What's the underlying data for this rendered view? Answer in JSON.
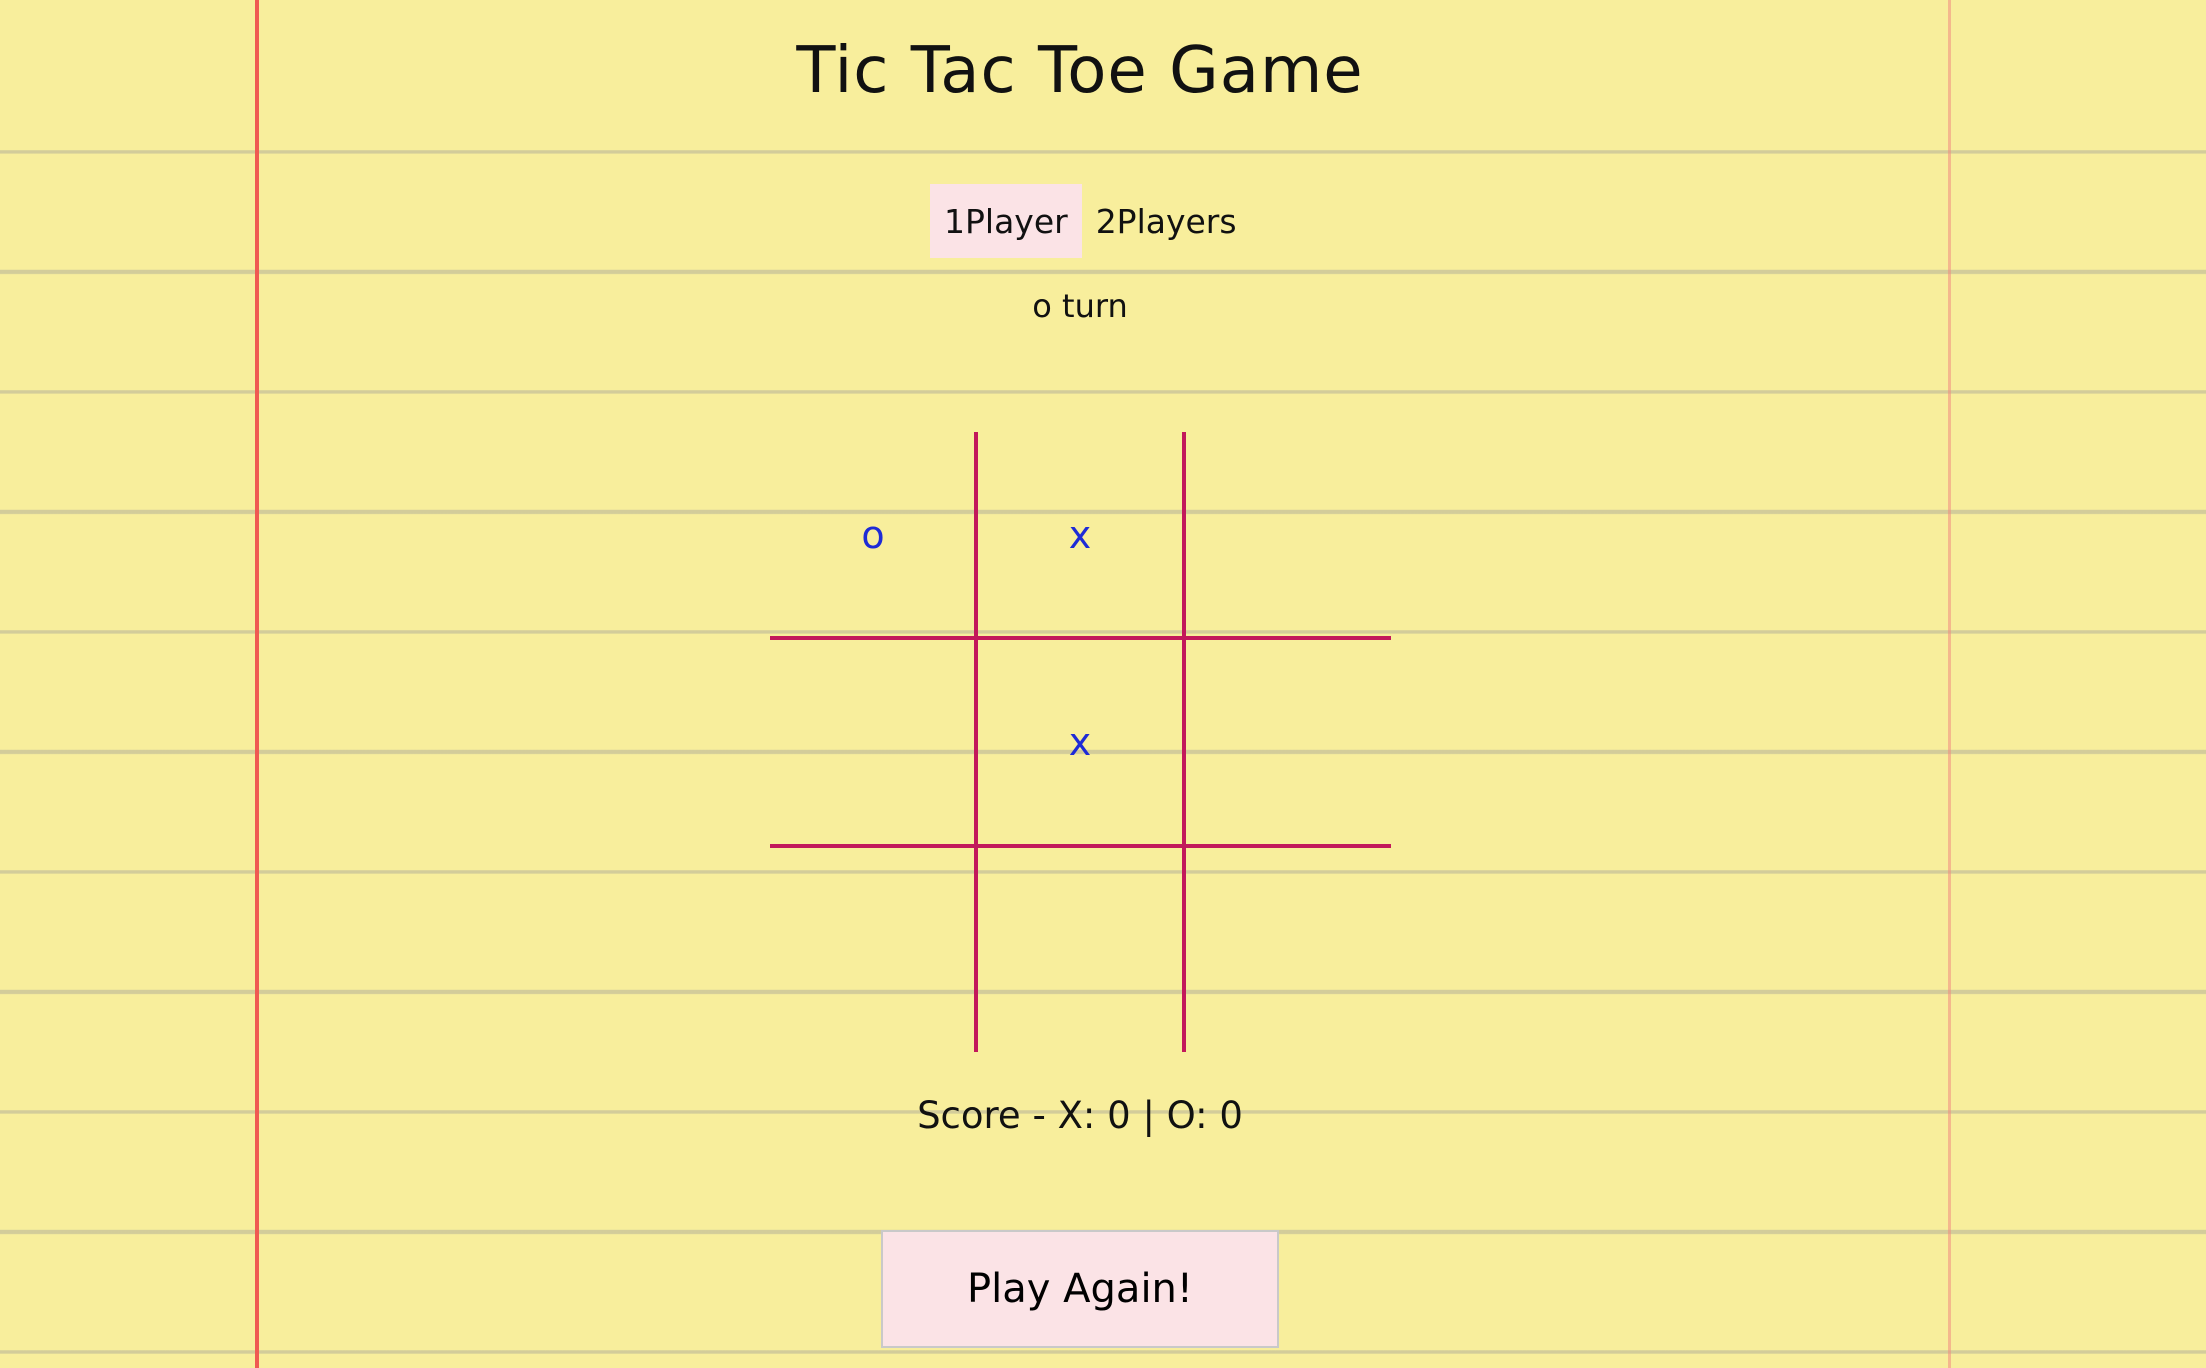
{
  "title": "Tic Tac Toe Game",
  "modes": [
    {
      "label": "1Player",
      "active": true
    },
    {
      "label": "2Players",
      "active": false
    }
  ],
  "turn_text": "o turn",
  "board": [
    "o",
    "x",
    "",
    "",
    "x",
    "",
    "",
    "",
    ""
  ],
  "score_text": "Score - X: 0 | O: 0",
  "play_again_label": "Play Again!",
  "colors": {
    "paper": "#f8ee9c",
    "grid": "#c2185b",
    "marks": "#1e2bd6",
    "button_bg": "#fbe3e6",
    "margin_line": "#ef5a52"
  }
}
